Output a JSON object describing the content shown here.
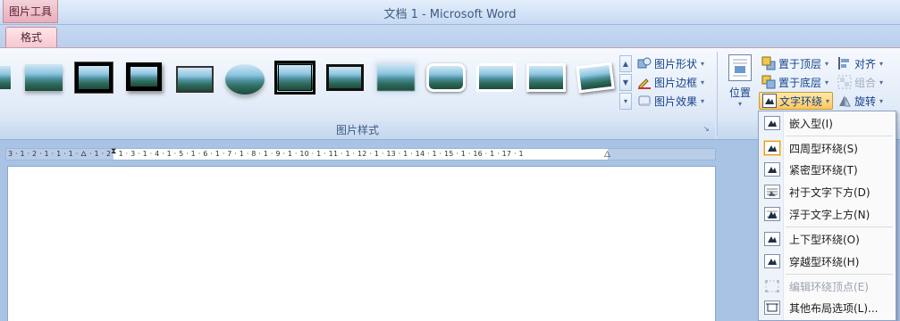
{
  "titlebar": {
    "context_tool": "图片工具",
    "title": "文档 1 - Microsoft Word"
  },
  "tabs": [
    {
      "label": "格式",
      "active": true
    }
  ],
  "ribbon": {
    "picture_styles": {
      "group_label": "图片样式",
      "commands": {
        "shape": "图片形状",
        "border": "图片边框",
        "effects": "图片效果"
      }
    },
    "arrange": {
      "position_label": "位置",
      "bring_front": "置于顶层",
      "send_back": "置于底层",
      "text_wrap": "文字环绕",
      "align": "对齐",
      "group": "组合",
      "rotate": "旋转"
    }
  },
  "wrap_menu": {
    "items": [
      {
        "label": "嵌入型(I)",
        "enabled": true
      },
      {
        "label": "四周型环绕(S)",
        "enabled": true,
        "hover": true
      },
      {
        "label": "紧密型环绕(T)",
        "enabled": true
      },
      {
        "label": "衬于文字下方(D)",
        "enabled": true
      },
      {
        "label": "浮于文字上方(N)",
        "enabled": true
      },
      {
        "label": "上下型环绕(O)",
        "enabled": true
      },
      {
        "label": "穿越型环绕(H)",
        "enabled": true
      },
      {
        "label": "编辑环绕顶点(E)",
        "enabled": false
      },
      {
        "label": "其他布局选项(L)...",
        "enabled": true
      }
    ]
  },
  "ruler": {
    "labels": "3 · 1 · 2 · 1 · 1 · 1 · 🜂 · 1 · 2 · 1 · 3 · 1 · 4 · 1 · 5 · 1 · 6 · 1 · 7 · 1 · 8 · 1 · 9 · 1 · 10 · 1 · 11 · 1 · 12 · 1 · 13 · 1 · 14 · 1 · 15 · 1 · 16 · 1 · 17 · 1"
  },
  "colors": {
    "accent": "#15428b",
    "context_tab": "#e8aebb",
    "hover": "#ffc85b"
  }
}
